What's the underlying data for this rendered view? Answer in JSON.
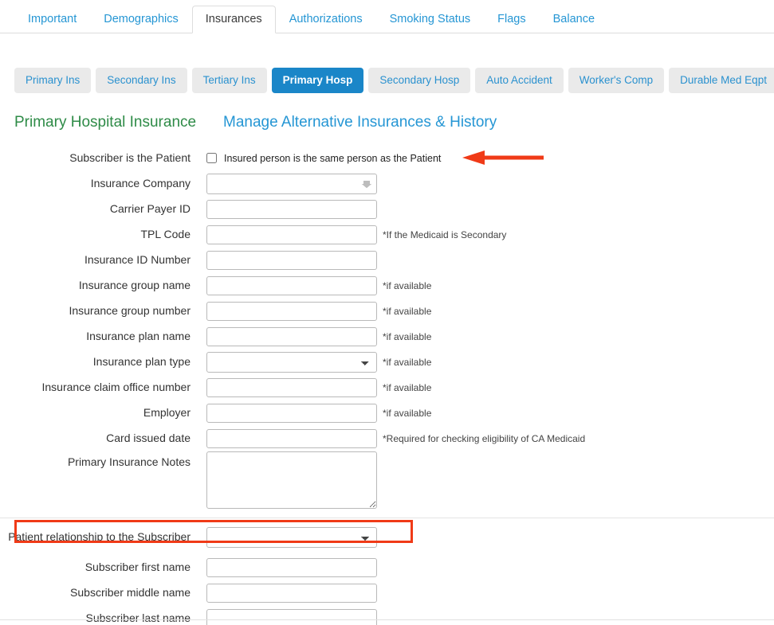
{
  "main_tabs": [
    {
      "label": "Important",
      "active": false
    },
    {
      "label": "Demographics",
      "active": false
    },
    {
      "label": "Insurances",
      "active": true
    },
    {
      "label": "Authorizations",
      "active": false
    },
    {
      "label": "Smoking Status",
      "active": false
    },
    {
      "label": "Flags",
      "active": false
    },
    {
      "label": "Balance",
      "active": false
    }
  ],
  "sub_tabs": [
    {
      "label": "Primary Ins",
      "active": false
    },
    {
      "label": "Secondary Ins",
      "active": false
    },
    {
      "label": "Tertiary Ins",
      "active": false
    },
    {
      "label": "Primary Hosp",
      "active": true
    },
    {
      "label": "Secondary Hosp",
      "active": false
    },
    {
      "label": "Auto Accident",
      "active": false
    },
    {
      "label": "Worker's Comp",
      "active": false
    },
    {
      "label": "Durable Med Eqpt",
      "active": false
    }
  ],
  "headings": {
    "section_title": "Primary Hospital Insurance",
    "manage_link": "Manage Alternative Insurances & History"
  },
  "form": {
    "subscriber_is_patient": {
      "label": "Subscriber is the Patient",
      "checkbox_text": "Insured person is the same person as the Patient",
      "checked": false
    },
    "insurance_company": {
      "label": "Insurance Company",
      "value": "",
      "hint": ""
    },
    "carrier_payer_id": {
      "label": "Carrier Payer ID",
      "value": "",
      "hint": ""
    },
    "tpl_code": {
      "label": "TPL Code",
      "value": "",
      "hint": "*If the Medicaid is Secondary"
    },
    "insurance_id_number": {
      "label": "Insurance ID Number",
      "value": "",
      "hint": ""
    },
    "insurance_group_name": {
      "label": "Insurance group name",
      "value": "",
      "hint": "*if available"
    },
    "insurance_group_number": {
      "label": "Insurance group number",
      "value": "",
      "hint": "*if available"
    },
    "insurance_plan_name": {
      "label": "Insurance plan name",
      "value": "",
      "hint": "*if available"
    },
    "insurance_plan_type": {
      "label": "Insurance plan type",
      "value": "",
      "hint": "*if available"
    },
    "insurance_claim_office_number": {
      "label": "Insurance claim office number",
      "value": "",
      "hint": "*if available"
    },
    "employer": {
      "label": "Employer",
      "value": "",
      "hint": "*if available"
    },
    "card_issued_date": {
      "label": "Card issued date",
      "value": "",
      "hint": "*Required for checking eligibility of CA Medicaid"
    },
    "primary_insurance_notes": {
      "label": "Primary Insurance Notes",
      "value": ""
    },
    "patient_relationship": {
      "label": "Patient relationship to the Subscriber",
      "value": ""
    },
    "subscriber_first_name": {
      "label": "Subscriber first name",
      "value": ""
    },
    "subscriber_middle_name": {
      "label": "Subscriber middle name",
      "value": ""
    },
    "subscriber_last_name": {
      "label": "Subscriber last name",
      "value": ""
    }
  },
  "annotations": {
    "arrow_color": "#f03a17",
    "highlight_box_color": "#f03a17",
    "arrow_target": "subscriber-is-patient-checkbox",
    "highlight_target": "patient-relationship-row"
  },
  "colors": {
    "active_subtab": "#1a86c8",
    "link_blue": "#2596d4",
    "heading_green": "#2e8b47"
  }
}
